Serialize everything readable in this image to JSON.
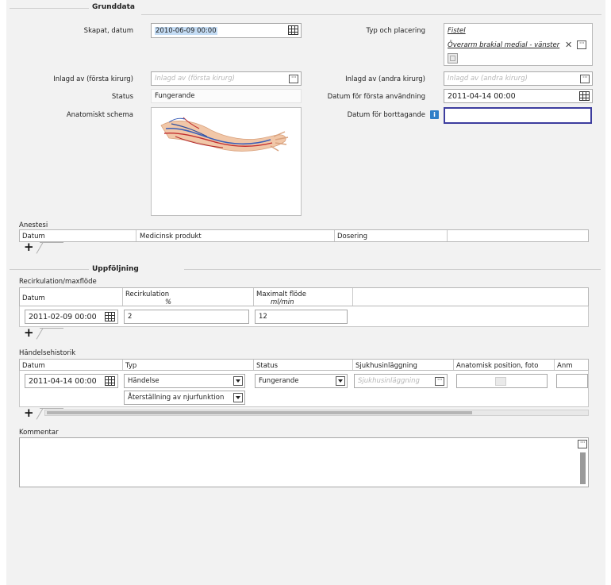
{
  "grunddata": {
    "section_title": "Grunddata",
    "skapat_label": "Skapat, datum",
    "skapat_value": "2010-06-09 00:00",
    "typ_label": "Typ och placering",
    "typ_link1": "Fistel",
    "typ_link2": "Överarm brakial medial - vänster",
    "inlagd1_label": "Inlagd av (första kirurg)",
    "inlagd1_placeholder": "Inlagd av (första kirurg)",
    "inlagd2_label": "Inlagd av (andra kirurg)",
    "inlagd2_placeholder": "Inlagd av (andra kirurg)",
    "status_label": "Status",
    "status_value": "Fungerande",
    "forsta_label": "Datum för första användning",
    "forsta_value": "2011-04-14 00:00",
    "anatomiskt_label": "Anatomiskt schema",
    "borttagande_label": "Datum för borttagande",
    "borttagande_value": ""
  },
  "anestesi": {
    "title": "Anestesi",
    "columns": [
      "Datum",
      "Medicinsk produkt",
      "Dosering"
    ]
  },
  "uppfoljning": {
    "section_title": "Uppföljning",
    "recirk_title": "Recirkulation/maxflöde",
    "col_datum": "Datum",
    "col_recirk": "Recirkulation",
    "col_recirk_unit": "%",
    "col_maxflode": "Maximalt flöde",
    "col_maxflode_unit": "ml/min",
    "row": {
      "datum": "2011-02-09 00:00",
      "recirk": "2",
      "maxflode": "12"
    }
  },
  "handelse": {
    "title": "Händelsehistorik",
    "columns": [
      "Datum",
      "Typ",
      "Status",
      "Sjukhusinläggning",
      "Anatomisk position, foto",
      "Anm"
    ],
    "row": {
      "datum": "2011-04-14 00:00",
      "typ1": "Händelse",
      "typ2": "Återställning av njurfunktion",
      "status": "Fungerande",
      "sjukhus_placeholder": "Sjukhusinläggning"
    }
  },
  "kommentar": {
    "title": "Kommentar",
    "value": ""
  },
  "icons": {
    "calendar": "calendar-icon",
    "more": "ellipsis-icon",
    "close": "close-icon",
    "info": "info-icon",
    "add": "plus-icon",
    "dropdown": "chevron-down-icon"
  }
}
